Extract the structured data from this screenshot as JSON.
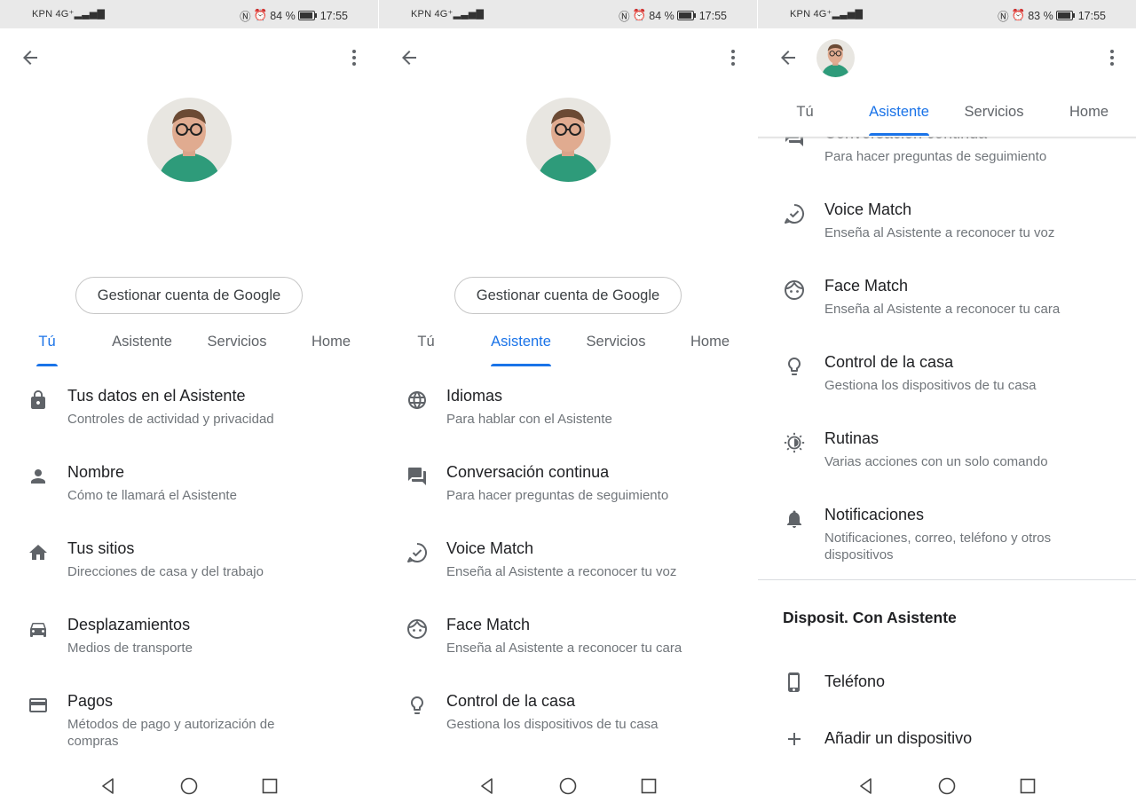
{
  "status": {
    "p1": {
      "carrier": "KPN",
      "network": "4G⁺",
      "battery": "84 %",
      "time": "17:55"
    },
    "p2": {
      "carrier": "KPN",
      "network": "4G⁺",
      "battery": "84 %",
      "time": "17:55"
    },
    "p3": {
      "carrier": "KPN",
      "network": "4G⁺",
      "battery": "83 %",
      "time": "17:55"
    }
  },
  "icons": {
    "back": "arrow-left-icon",
    "more": "more-vert-icon"
  },
  "google_button": "Gestionar cuenta de Google",
  "tabs": [
    "Tú",
    "Asistente",
    "Servicios",
    "Home"
  ],
  "panel1": {
    "active_tab": "Tú",
    "items": [
      {
        "title": "Tus datos en el Asistente",
        "sub": "Controles de actividad y privacidad",
        "icon": "lock-icon"
      },
      {
        "title": "Nombre",
        "sub": "Cómo te llamará el Asistente",
        "icon": "person-icon"
      },
      {
        "title": "Tus sitios",
        "sub": "Direcciones de casa y del trabajo",
        "icon": "home-icon"
      },
      {
        "title": "Desplazamientos",
        "sub": "Medios de transporte",
        "icon": "car-icon"
      },
      {
        "title": "Pagos",
        "sub": "Métodos de pago y autorización de compras",
        "icon": "credit-card-icon"
      }
    ]
  },
  "panel2": {
    "active_tab": "Asistente",
    "items": [
      {
        "title": "Idiomas",
        "sub": "Para hablar con el Asistente",
        "icon": "globe-icon"
      },
      {
        "title": "Conversación continua",
        "sub": "Para hacer preguntas de seguimiento",
        "icon": "chat-icon"
      },
      {
        "title": "Voice Match",
        "sub": "Enseña al Asistente a reconocer tu voz",
        "icon": "voice-match-icon"
      },
      {
        "title": "Face Match",
        "sub": "Enseña al Asistente a reconocer tu cara",
        "icon": "face-icon"
      },
      {
        "title": "Control de la casa",
        "sub": "Gestiona los dispositivos de tu casa",
        "icon": "lightbulb-icon"
      }
    ]
  },
  "panel3": {
    "active_tab": "Asistente",
    "partial_item": {
      "title": "Conversación continua",
      "sub": "Para hacer preguntas de seguimiento",
      "icon": "chat-icon"
    },
    "items": [
      {
        "title": "Voice Match",
        "sub": "Enseña al Asistente a reconocer tu voz",
        "icon": "voice-match-icon"
      },
      {
        "title": "Face Match",
        "sub": "Enseña al Asistente a reconocer tu cara",
        "icon": "face-icon"
      },
      {
        "title": "Control de la casa",
        "sub": "Gestiona los dispositivos de tu casa",
        "icon": "lightbulb-icon"
      },
      {
        "title": "Rutinas",
        "sub": "Varias acciones con un solo comando",
        "icon": "routines-icon"
      },
      {
        "title": "Notificaciones",
        "sub": "Notificaciones, correo, teléfono y otros dispositivos",
        "icon": "bell-icon"
      }
    ],
    "section_title": "Disposit. Con Asistente",
    "devices": [
      {
        "title": "Teléfono",
        "icon": "phone-icon"
      },
      {
        "title": "Añadir un dispositivo",
        "icon": "add-icon"
      }
    ]
  },
  "colors": {
    "accent": "#1a73e8",
    "text": "#202124",
    "secondary": "#70757a",
    "icon": "#5f6368"
  }
}
